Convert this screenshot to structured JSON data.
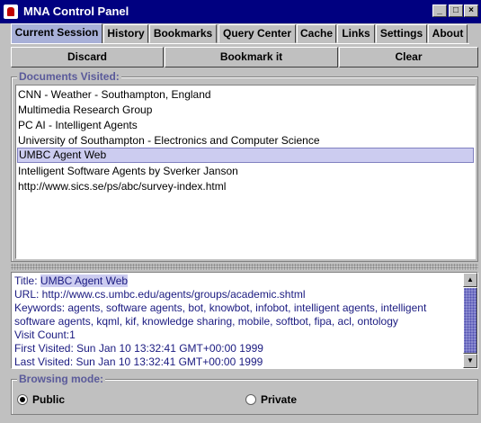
{
  "window": {
    "title": "MNA Control Panel"
  },
  "tabs": [
    {
      "label": "Current Session",
      "active": true
    },
    {
      "label": "History",
      "active": false
    },
    {
      "label": "Bookmarks",
      "active": false
    },
    {
      "label": "Query Center",
      "active": false
    },
    {
      "label": "Cache",
      "active": false
    },
    {
      "label": "Links",
      "active": false
    },
    {
      "label": "Settings",
      "active": false
    },
    {
      "label": "About",
      "active": false
    }
  ],
  "toolbar": {
    "discard_label": "Discard",
    "bookmark_label": "Bookmark it",
    "clear_label": "Clear"
  },
  "documents": {
    "label": "Documents Visited:",
    "items": [
      "CNN - Weather - Southampton, England",
      "Multimedia Research Group",
      "PC AI - Intelligent Agents",
      "University of Southampton - Electronics and Computer Science",
      "UMBC Agent Web",
      "Intelligent Software Agents by Sverker Janson",
      "http://www.sics.se/ps/abc/survey-index.html"
    ],
    "selected_index": 4
  },
  "details": {
    "title_prefix": "Title: ",
    "title_value": "UMBC Agent Web",
    "url": "URL: http://www.cs.umbc.edu/agents/groups/academic.shtml",
    "keywords": "Keywords: agents, software agents, bot, knowbot, infobot, intelligent agents, intelligent software agents, kqml, kif, knowledge sharing, mobile, softbot, fipa, acl, ontology",
    "visit_count": "Visit Count:1",
    "first_visited": "First Visited: Sun Jan 10 13:32:41 GMT+00:00 1999",
    "last_visited": "Last Visited: Sun Jan 10 13:32:41 GMT+00:00 1999"
  },
  "browsing_mode": {
    "label": "Browsing mode:",
    "public_label": "Public",
    "private_label": "Private",
    "selected": "Public"
  },
  "colors": {
    "titlebar": "#000080",
    "active_tab": "#a8b0d8",
    "selection": "#ccccf0",
    "detail_text": "#1a1a80"
  }
}
